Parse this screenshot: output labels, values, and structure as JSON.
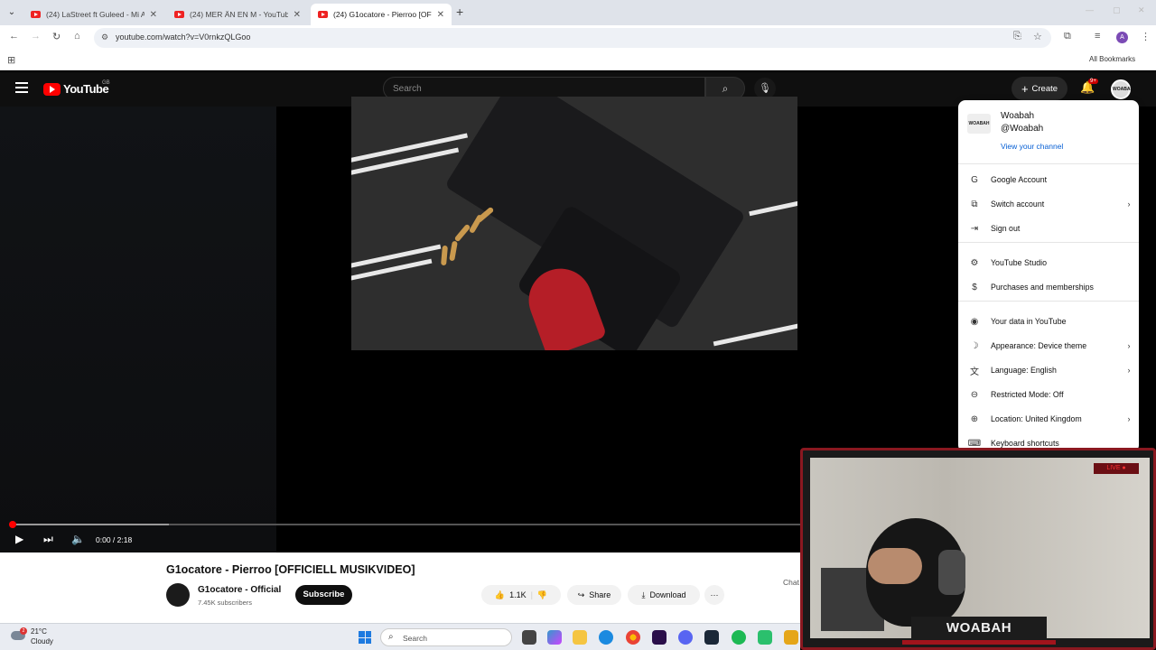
{
  "browser": {
    "tabs": [
      {
        "label": "(24) LaStreet ft Guleed - Mi Amor",
        "active": false
      },
      {
        "label": "(24) MER ÄN EN M - YouTube",
        "active": false
      },
      {
        "label": "(24) G1ocatore - Pierroo [OFFICIELL",
        "active": true
      }
    ],
    "tab_close": "✕",
    "new_tab": "+",
    "url": "youtube.com/watch?v=V0rnkzQLGoo",
    "all_bookmarks": "All Bookmarks",
    "profile_initial": "A"
  },
  "youtube": {
    "logo_text": "YouTube",
    "region": "GB",
    "search_placeholder": "Search",
    "create_label": "Create",
    "notif_badge": "9+",
    "avatar_text": "WOABAH"
  },
  "player": {
    "time": "0:00 / 2:18",
    "progress": 0.0,
    "buffered": 0.2
  },
  "video": {
    "title": "G1ocatore - Pierroo [OFFICIELL MUSIKVIDEO]",
    "channel": "G1ocatore - Official",
    "subscribers": "7.45K subscribers",
    "subscribe_label": "Subscribe",
    "likes": "1.1K",
    "share_label": "Share",
    "download_label": "Download",
    "more_label": "···",
    "chat_label": "Chat"
  },
  "account_menu": {
    "avatar_text": "WOABAH",
    "name": "Woabah",
    "handle": "@Woabah",
    "channel_link": "View your channel",
    "items": [
      {
        "label": "Google Account",
        "icon": "G",
        "chevron": false
      },
      {
        "label": "Switch account",
        "icon": "⧉",
        "chevron": true
      },
      {
        "label": "Sign out",
        "icon": "⇥",
        "chevron": false
      },
      {
        "label": "YouTube Studio",
        "icon": "⚙",
        "chevron": false
      },
      {
        "label": "Purchases and memberships",
        "icon": "$",
        "chevron": false
      },
      {
        "label": "Your data in YouTube",
        "icon": "◉",
        "chevron": false
      },
      {
        "label": "Appearance: Device theme",
        "icon": "☽",
        "chevron": true
      },
      {
        "label": "Language: English",
        "icon": "文",
        "chevron": true
      },
      {
        "label": "Restricted Mode: Off",
        "icon": "⊖",
        "chevron": false
      },
      {
        "label": "Location: United Kingdom",
        "icon": "⊕",
        "chevron": true
      },
      {
        "label": "Keyboard shortcuts",
        "icon": "⌨",
        "chevron": false
      }
    ]
  },
  "webcam": {
    "name": "WOABAH",
    "live": "LIVE ●"
  },
  "taskbar": {
    "weather_temp": "21°C",
    "weather_cond": "Cloudy",
    "weather_badge": "2",
    "search_placeholder": "Search"
  },
  "colors": {
    "yt_red": "#ff0000",
    "link_blue": "#065fd4",
    "cam_border": "#8a1820"
  }
}
